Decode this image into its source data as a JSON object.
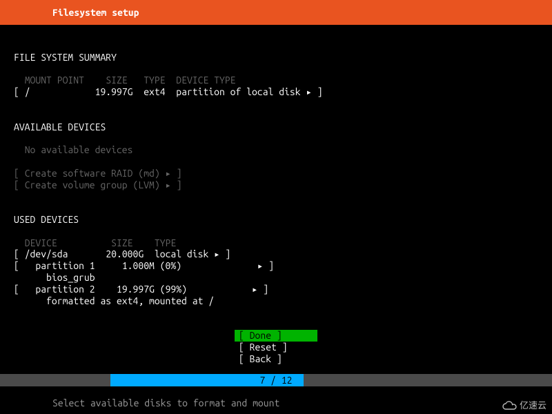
{
  "title": "Filesystem setup",
  "fss": {
    "header": "FILE SYSTEM SUMMARY",
    "cols": {
      "mount": "MOUNT POINT",
      "size": "SIZE",
      "type": "TYPE",
      "devtype": "DEVICE TYPE"
    },
    "row": {
      "mount": "/",
      "size": "19.997G",
      "type": "ext4",
      "devtype": "partition of local disk"
    }
  },
  "avail": {
    "header": "AVAILABLE DEVICES",
    "none": "No available devices",
    "raid": "Create software RAID (md)",
    "lvm": "Create volume group (LVM)"
  },
  "used": {
    "header": "USED DEVICES",
    "cols": {
      "device": "DEVICE",
      "size": "SIZE",
      "type": "TYPE"
    },
    "disk": {
      "name": "/dev/sda",
      "size": "20.000G",
      "type": "local disk"
    },
    "p1": {
      "name": "partition 1",
      "size": "1.000M",
      "pct": "(0%)",
      "sub": "bios_grub"
    },
    "p2": {
      "name": "partition 2",
      "size": "19.997G",
      "pct": "(99%)",
      "sub": "formatted as ext4, mounted at /"
    }
  },
  "buttons": {
    "done": "Done",
    "reset": "Reset",
    "back": "Back"
  },
  "progress": {
    "current": 7,
    "total": 12,
    "label": "7 / 12",
    "percent": 58
  },
  "hint": "Select available disks to format and mount",
  "watermark": "亿速云"
}
